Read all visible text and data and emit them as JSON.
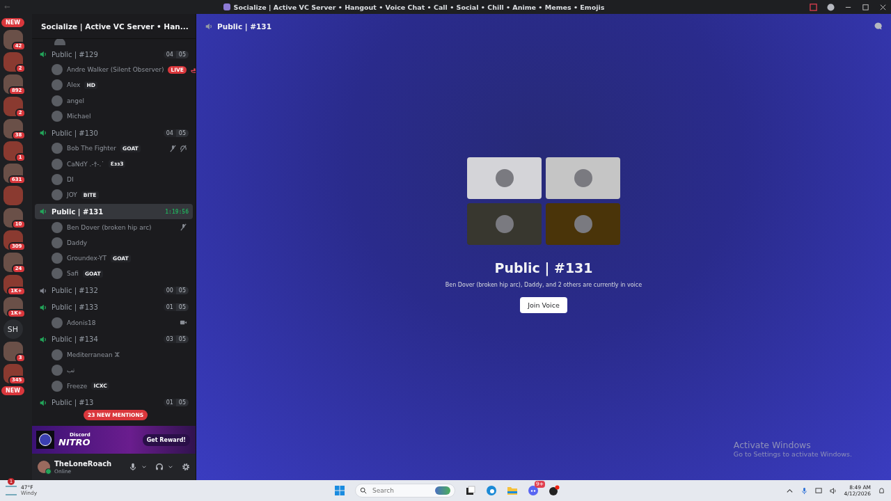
{
  "title_bar": {
    "title": "Socialize | Active VC Server • Hangout • Voice Chat • Call • Social • Chill • Anime • Memes • Emojis"
  },
  "servers": [
    {
      "kind": "pill",
      "label": "NEW"
    },
    {
      "kind": "icon",
      "badge": "42"
    },
    {
      "kind": "icon",
      "badge": "2"
    },
    {
      "kind": "icon",
      "badge": "892"
    },
    {
      "kind": "icon",
      "badge": "2"
    },
    {
      "kind": "icon",
      "badge": "38"
    },
    {
      "kind": "icon",
      "badge": "1"
    },
    {
      "kind": "icon",
      "badge": "631"
    },
    {
      "kind": "icon"
    },
    {
      "kind": "icon",
      "badge": "10"
    },
    {
      "kind": "icon",
      "badge": "309"
    },
    {
      "kind": "icon",
      "badge": "24"
    },
    {
      "kind": "icon",
      "badge": "1K+"
    },
    {
      "kind": "icon",
      "badge": "1K+"
    },
    {
      "kind": "text",
      "label": "SH"
    },
    {
      "kind": "icon",
      "badge": "3"
    },
    {
      "kind": "icon",
      "badge": "345"
    },
    {
      "kind": "pill",
      "label": "NEW"
    }
  ],
  "server_header": {
    "name": "Socialize | Active VC Server • Han..."
  },
  "channels": [
    {
      "name": "Public | #129",
      "selected": false,
      "active": true,
      "users": "04",
      "limit": "05",
      "members": [
        {
          "name": "Andre Walker (Silent Observer)",
          "tag": {
            "kind": "live",
            "text": "LIVE"
          },
          "streaming": true
        },
        {
          "name": "Alex",
          "tag": {
            "kind": "role",
            "text": "HD"
          }
        },
        {
          "name": "angel"
        },
        {
          "name": "Michael"
        }
      ]
    },
    {
      "name": "Public | #130",
      "selected": false,
      "active": true,
      "users": "04",
      "limit": "05",
      "members": [
        {
          "name": "Bob The Fighter",
          "tag": {
            "kind": "role",
            "text": "GOAT"
          },
          "muted": true,
          "deafened": true
        },
        {
          "name": "CaNdY .‐†‐.˙",
          "tag": {
            "kind": "role",
            "text": "Ɛɜɜ3"
          }
        },
        {
          "name": "DI"
        },
        {
          "name": "JOY",
          "tag": {
            "kind": "role",
            "text": "BITE"
          }
        }
      ]
    },
    {
      "name": "Public | #131",
      "selected": true,
      "active": true,
      "timer": "1:19:56",
      "members": [
        {
          "name": "Ben Dover (broken hip arc)",
          "muted": true
        },
        {
          "name": "Daddy"
        },
        {
          "name": "Groundex-YT",
          "tag": {
            "kind": "role",
            "text": "GOAT"
          }
        },
        {
          "name": "Safi",
          "tag": {
            "kind": "role",
            "text": "GOAT"
          }
        }
      ]
    },
    {
      "name": "Public | #132",
      "selected": false,
      "active": false,
      "users": "00",
      "limit": "05"
    },
    {
      "name": "Public | #133",
      "selected": false,
      "active": true,
      "users": "01",
      "limit": "05",
      "members": [
        {
          "name": "Adonis18",
          "video": true
        }
      ]
    },
    {
      "name": "Public | #134",
      "selected": false,
      "active": true,
      "users": "03",
      "limit": "05",
      "members": [
        {
          "name": "Mediterranean ⵣ"
        },
        {
          "name": "تب"
        },
        {
          "name": "Freeze",
          "tag": {
            "kind": "role",
            "text": "ICXC"
          }
        }
      ]
    },
    {
      "name": "Public | #13",
      "selected": false,
      "active": true,
      "users": "01",
      "limit": "05"
    }
  ],
  "mentions_pill": "23 NEW MENTIONS",
  "nitro": {
    "brand": "Discord",
    "product": "NITRO",
    "button": "Get Reward!"
  },
  "user": {
    "name": "TheLoneRoach",
    "status": "Online"
  },
  "main": {
    "channel": "Public | #131",
    "heading": "Public | #131",
    "subtitle": "Ben Dover (broken hip arc), Daddy, and 2 others are currently in voice",
    "button": "Join Voice",
    "tiles": [
      {
        "color": "#d4d4d8"
      },
      {
        "color": "#c5c5c5"
      },
      {
        "color": "#38372f"
      },
      {
        "color": "#4a3409"
      }
    ]
  },
  "activation": {
    "title": "Activate Windows",
    "text": "Go to Settings to activate Windows."
  },
  "taskbar": {
    "weather_badge": "1",
    "temp": "47°F",
    "weather": "Windy",
    "search": {
      "placeholder": "Search"
    },
    "discord_badge": "9+",
    "time": "8:49 AM",
    "date": "4/12/2026"
  }
}
